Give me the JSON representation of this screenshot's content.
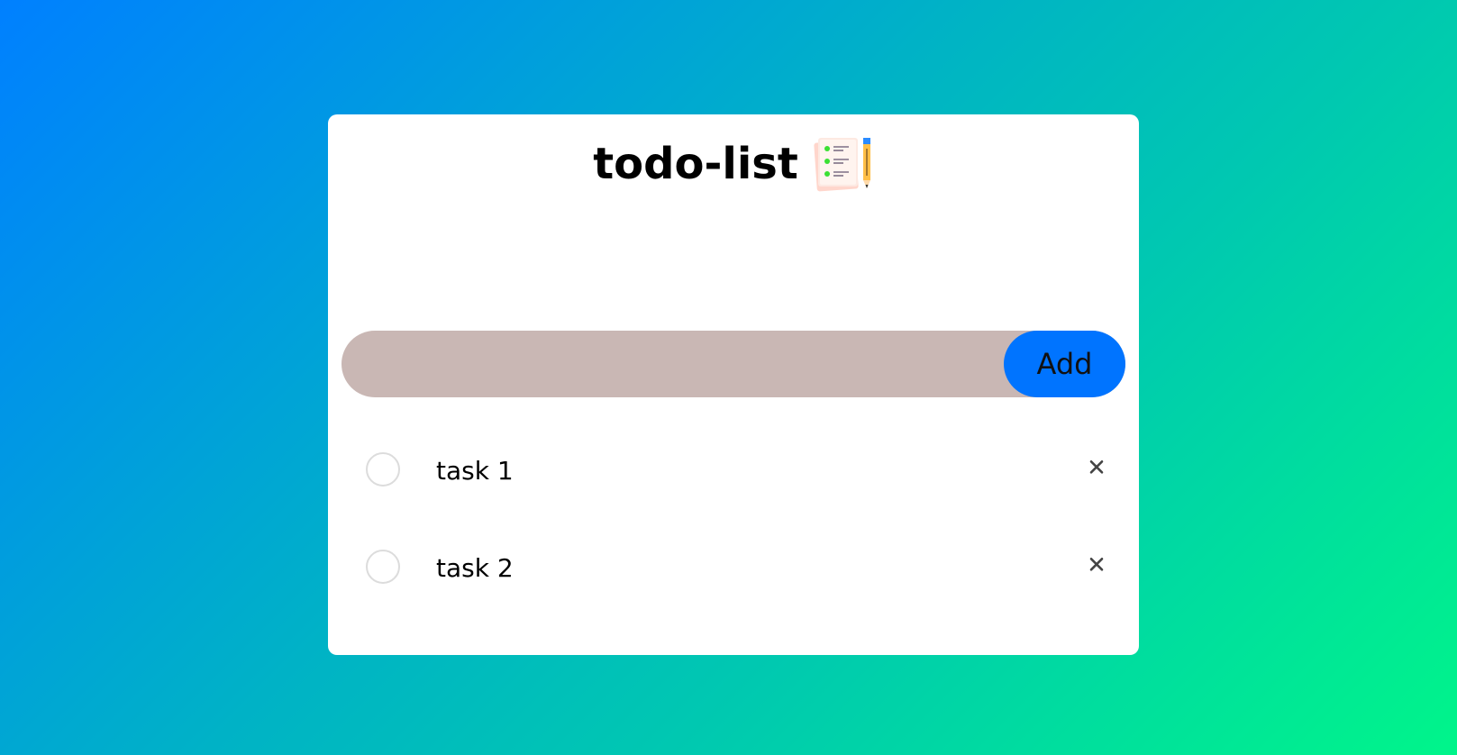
{
  "app": {
    "title": "todo-list",
    "logo_icon": "checklist-with-pencil-icon"
  },
  "input": {
    "value": "",
    "placeholder": ""
  },
  "add_button": {
    "label": "Add"
  },
  "tasks": [
    {
      "label": "task 1",
      "done": false
    },
    {
      "label": "task 2",
      "done": false
    }
  ],
  "colors": {
    "background_start": "#0080ff",
    "background_end": "#00f58a",
    "card": "#ffffff",
    "input_background": "#c9b7b4",
    "add_button": "#0074ff",
    "checkbox_border": "#dcdcdc",
    "delete_icon": "#444444"
  }
}
